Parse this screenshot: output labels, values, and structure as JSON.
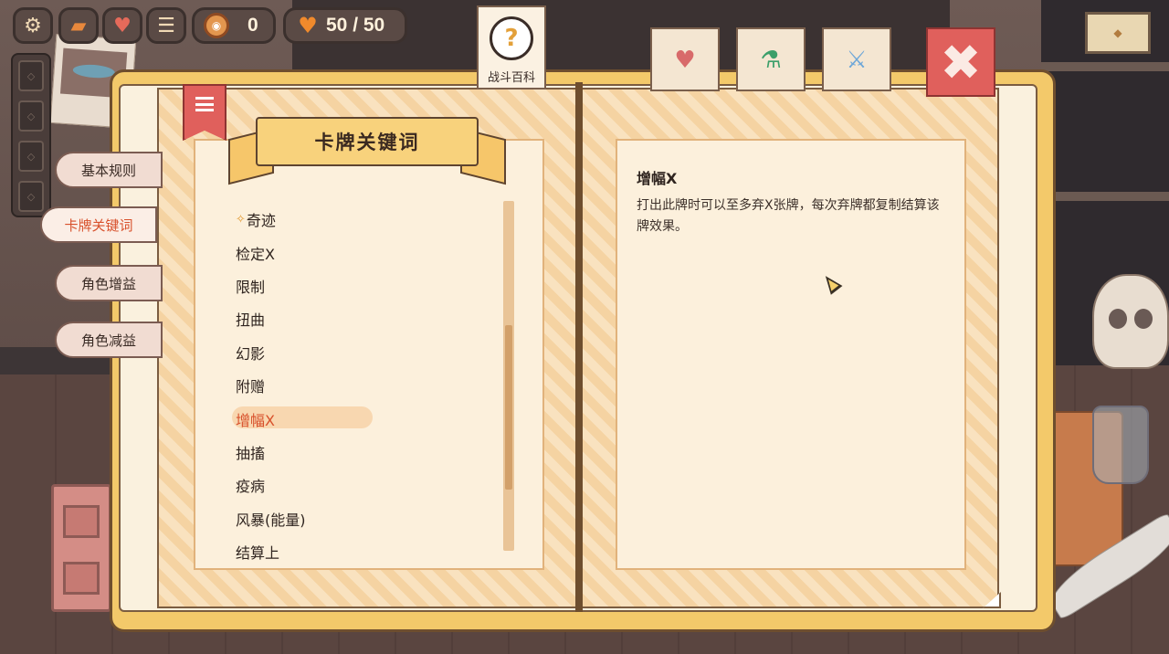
{
  "hud": {
    "coins": "0",
    "health": "50 / 50"
  },
  "top_tabs": [
    {
      "label": "战斗百科",
      "icon": "question-mark-icon"
    },
    {
      "icon": "heart-card-icon"
    },
    {
      "icon": "potion-icon"
    },
    {
      "icon": "sword-icon"
    }
  ],
  "side_tabs": [
    "基本规则",
    "卡牌关键词",
    "角色增益",
    "角色减益"
  ],
  "page_title": "卡牌关键词",
  "keywords": [
    {
      "mark": "✧",
      "label": "奇迹"
    },
    {
      "label": "检定X"
    },
    {
      "label": "限制"
    },
    {
      "label": "扭曲"
    },
    {
      "label": "幻影"
    },
    {
      "label": "附赠"
    },
    {
      "label": "增幅X",
      "selected": true
    },
    {
      "label": "抽搐"
    },
    {
      "label": "疫病"
    },
    {
      "label": "风暴(能量)"
    },
    {
      "label": "结算上"
    }
  ],
  "detail": {
    "title": "增幅X",
    "description": "打出此牌时可以至多弃X张牌，每次弃牌都复制结算该牌效果。"
  },
  "colors": {
    "accent": "#d8512c",
    "book": "#f3c96a",
    "close": "#e0605c"
  }
}
